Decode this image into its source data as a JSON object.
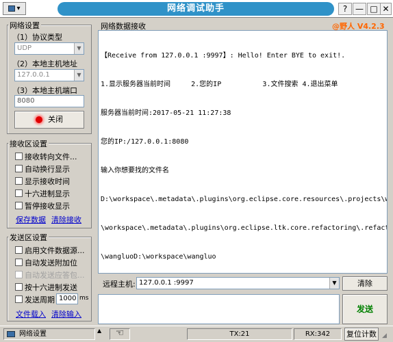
{
  "window": {
    "title": "网络调试助手",
    "sysmenu": "▾",
    "btn_help": "?",
    "btn_min": "—",
    "btn_max": "□",
    "btn_close": "✕"
  },
  "net_settings": {
    "title": "网络设置",
    "protocol_label": "（1）协议类型",
    "protocol_value": "UDP",
    "host_label": "（2）本地主机地址",
    "host_value": "127.0.0.1",
    "port_label": "（3）本地主机端口",
    "port_value": "8080",
    "close_label": "关闭"
  },
  "recv_settings": {
    "title": "接收区设置",
    "options": [
      "接收转向文件...",
      "自动换行显示",
      "显示接收时间",
      "十六进制显示",
      "暂停接收显示"
    ],
    "save_link": "保存数据",
    "clear_link": "清除接收"
  },
  "send_settings": {
    "title": "发送区设置",
    "options": [
      "启用文件数据源...",
      "自动发送附加位",
      "自动发送应答包...",
      "按十六进制发送",
      "发送周期"
    ],
    "period_value": "1000",
    "period_unit": "ms",
    "load_link": "文件载入",
    "clear_link": "清除输入"
  },
  "recv_area": {
    "title": "网络数据接收",
    "brand": "@野人 V4.2.3",
    "lines": [
      "【Receive from 127.0.0.1 :9997】: Hello! Enter BYE to exit!.",
      "1.显示服务器当前时间     2.您的IP          3.文件搜索 4.退出菜单",
      "服务器当前时间:2017-05-21 11:27:38",
      "您的IP:/127.0.0.1:8080",
      "输入你想要找的文件名",
      "D:\\workspace\\.metadata\\.plugins\\org.eclipse.core.resources\\.projects\\wangluoD:",
      "\\workspace\\.metadata\\.plugins\\org.eclipse.ltk.core.refactoring\\.refactorings",
      "\\wangluoD:\\workspace\\wangluo"
    ]
  },
  "remote": {
    "label": "远程主机:",
    "value": "127.0.0.1 :9997",
    "clear_label": "清除"
  },
  "send_button": "发送",
  "status": {
    "arrow": "▲",
    "net_label": "网络设置",
    "tx": "TX:21",
    "rx": "RX:342",
    "reset": "复位计数"
  },
  "colors": {
    "accent": "#2f92c8",
    "brand": "#ff6600",
    "send_text": "#008000",
    "link": "#0000cc"
  }
}
